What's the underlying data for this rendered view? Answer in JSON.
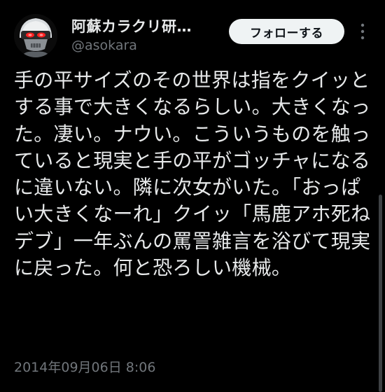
{
  "header": {
    "display_name": "阿蘇カラクリ研…",
    "handle": "@asokara",
    "follow_label": "フォローする",
    "more_icon": "more-vertical-icon"
  },
  "tweet": {
    "text": "手の平サイズのその世界は指をクイッとする事で大きくなるらしい。大きくなった。凄い。ナウい。こういうものを触っていると現実と手の平がゴッチャになるに違いない。隣に次女がいた。「おっぱい大きくなーれ」クイッ「馬鹿アホ死ねデブ」一年ぶんの罵詈雑言を浴びて現実に戻った。何と恐ろしい機械。",
    "timestamp": "2014年09月06日 8:06"
  },
  "colors": {
    "background": "#000000",
    "text_primary": "#e7e9ea",
    "text_secondary": "#71767b",
    "button_bg": "#eff3f4",
    "button_text": "#0f1419",
    "avatar_eyes": "#ff2020"
  }
}
